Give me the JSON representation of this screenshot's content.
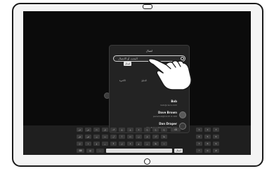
{
  "dialog": {
    "title": "اتصال",
    "search_placeholder": "البحث أو الاتصال",
    "chip_label": "اتصال",
    "tabs": [
      "الأخيرة",
      "الدليل",
      "المفضلة"
    ]
  },
  "contacts": [
    {
      "name": "Bob",
      "detail": "bob@cisco.com"
    },
    {
      "name": "Dave Brown",
      "detail": "personal@10.47.4.100"
    },
    {
      "name": "Dan Draper",
      "detail": "dan.draper@somewhere.com"
    }
  ],
  "keyboard": {
    "action_key_label": "اتصال",
    "rows": [
      [
        "ض",
        "ص",
        "ث",
        "ق",
        "ف",
        "غ",
        "ع",
        "ه",
        "خ",
        "ح",
        "ج"
      ],
      [
        "ش",
        "س",
        "ي",
        "ب",
        "ل",
        "ا",
        "ت",
        "ن",
        "م",
        "ك",
        "ط"
      ],
      [
        "ئ",
        "ء",
        "ؤ",
        "ر",
        "لا",
        "ى",
        "ة",
        "و",
        "ز",
        "ظ",
        "د"
      ]
    ],
    "numpad": [
      [
        "1",
        "2",
        "3"
      ],
      [
        "4",
        "5",
        "6"
      ],
      [
        "7",
        "8",
        "9"
      ],
      [
        "*",
        "0",
        "#"
      ]
    ]
  }
}
